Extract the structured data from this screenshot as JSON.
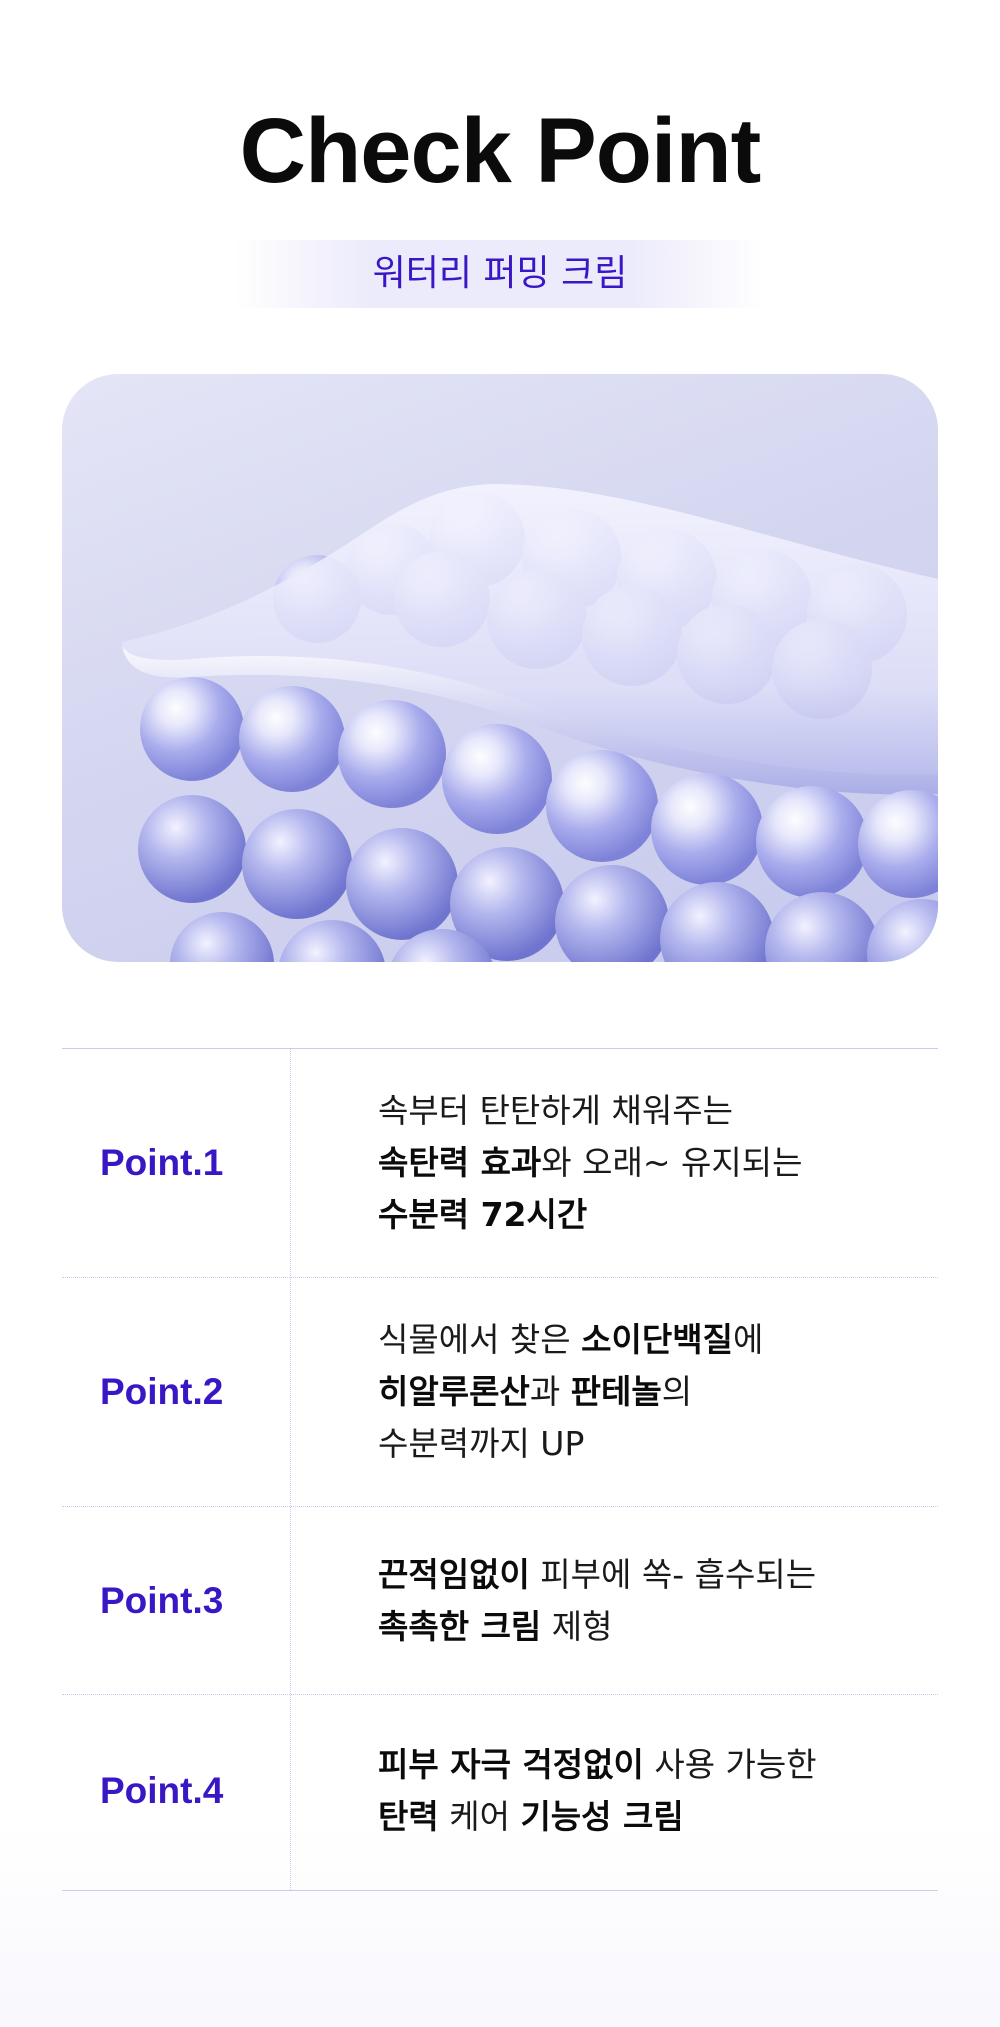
{
  "header": {
    "title": "Check Point",
    "subtitle": "워터리 퍼밍 크림"
  },
  "hero_image": {
    "description_icon": "cream-layer-over-spheres-illustration"
  },
  "colors": {
    "accent": "#3a17c4",
    "divider": "#c9cbea",
    "hero_bg": "#d3d5f0"
  },
  "points": [
    {
      "label": "Point.1",
      "lines": [
        [
          {
            "t": "속부터 탄탄하게 채워주는",
            "b": false
          }
        ],
        [
          {
            "t": "속탄력 효과",
            "b": true
          },
          {
            "t": "와 오래~ 유지되는",
            "b": false
          }
        ],
        [
          {
            "t": "수분력 72시간",
            "b": true
          }
        ]
      ]
    },
    {
      "label": "Point.2",
      "lines": [
        [
          {
            "t": "식물에서 찾은 ",
            "b": false
          },
          {
            "t": "소이단백질",
            "b": true
          },
          {
            "t": "에",
            "b": false
          }
        ],
        [
          {
            "t": "히알루론산",
            "b": true
          },
          {
            "t": "과 ",
            "b": false
          },
          {
            "t": "판테놀",
            "b": true
          },
          {
            "t": "의",
            "b": false
          }
        ],
        [
          {
            "t": "수분력까지 UP",
            "b": false
          }
        ]
      ]
    },
    {
      "label": "Point.3",
      "lines": [
        [
          {
            "t": "끈적임없이",
            "b": true
          },
          {
            "t": " 피부에 쏙- 흡수되는",
            "b": false
          }
        ],
        [
          {
            "t": "촉촉한 크림",
            "b": true
          },
          {
            "t": " 제형",
            "b": false
          }
        ]
      ]
    },
    {
      "label": "Point.4",
      "lines": [
        [
          {
            "t": "피부 자극 걱정없이",
            "b": true
          },
          {
            "t": " 사용 가능한",
            "b": false
          }
        ],
        [
          {
            "t": "탄력",
            "b": true
          },
          {
            "t": " 케어 ",
            "b": false
          },
          {
            "t": "기능성 크림",
            "b": true
          }
        ]
      ]
    }
  ]
}
